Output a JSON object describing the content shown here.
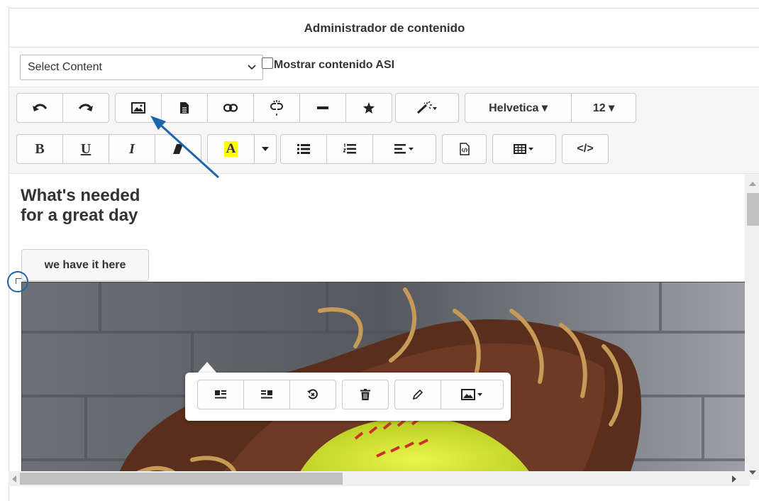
{
  "header": {
    "title": "Administrador de contenido"
  },
  "content_select": {
    "value": "Select Content",
    "chevron_icon": "chevron-down-icon"
  },
  "asi_toggle": {
    "label": "Mostrar contenido ASI",
    "checked": false
  },
  "toolbar": {
    "font_family": "Helvetica ▾",
    "font_size": "12 ▾",
    "bold": "B",
    "underline": "U",
    "italic": "I",
    "highlight": "A",
    "source_code": "</>",
    "highlight_color": "#ffff00"
  },
  "editor": {
    "heading_line1": "What's needed",
    "heading_line2": "for a great day",
    "cta_label": "we have it here"
  },
  "annotation": {
    "color": "#1c66b0"
  }
}
